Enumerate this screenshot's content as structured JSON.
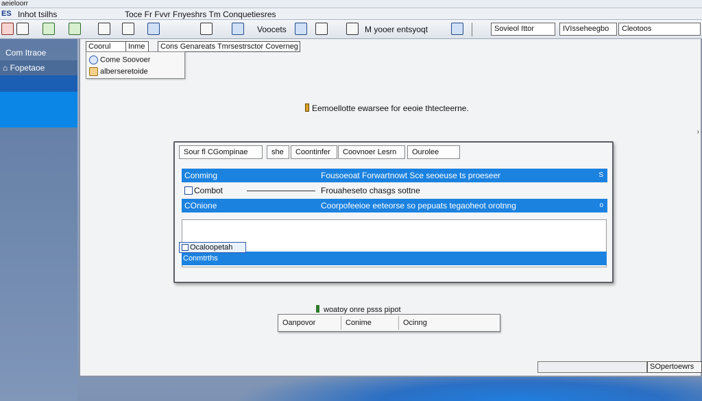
{
  "app": {
    "strip_title": "aeieloorr",
    "menu_tag": "ES",
    "menu_label": "Inhot tsilhs",
    "window_title": "Toce Fr Fvvr Fnyeshrs Tm Conquetiesres"
  },
  "toolbar": {
    "icon_labels": [
      "",
      "",
      "",
      "",
      "",
      "",
      ""
    ],
    "text_1": "Voocets",
    "text_2": "M yooer entsyoqt",
    "field_1": "Sovieol Ittor",
    "field_2": "IVIsseheegbo",
    "field_3": "Cleotoos"
  },
  "sidebar": {
    "item_1": "Com Itraoe",
    "item_2": "Fopetaoe"
  },
  "main": {
    "tabs": [
      "Coorul",
      "Inme",
      "Cons Genareats Tmrsestrsctor Coverneg"
    ],
    "popup": {
      "row_1": "Come Soovoer",
      "row_2": "alberseretoide"
    },
    "instruction": "Eemoellotte ewarsee for eeoie thtecteerne.",
    "panel": {
      "headers": [
        "Sour fl CGompinae",
        "she",
        "Coontinfer",
        "Coovnoer Lesrn",
        "Ourolee"
      ],
      "rows": [
        {
          "label": "Conming",
          "desc": "Fousoeoat Forwartnowt Sce seoeuse ts proeseer",
          "end": "S"
        },
        {
          "label": "Combot",
          "desc": "Frouaheseto chasgs sottne",
          "end": ""
        },
        {
          "label": "COnione",
          "desc": "Coorpofeeioe eeteorse so pepuats tegaoheot orotnng",
          "end": "o"
        }
      ],
      "chip": "Ocaloopetah",
      "footer": "Conmtrths"
    },
    "prompt": "woatoy onre psss pipot",
    "buttons": [
      "Oanpovor",
      "Conime",
      "Ocinng"
    ],
    "status": "SOpertoewrs"
  }
}
